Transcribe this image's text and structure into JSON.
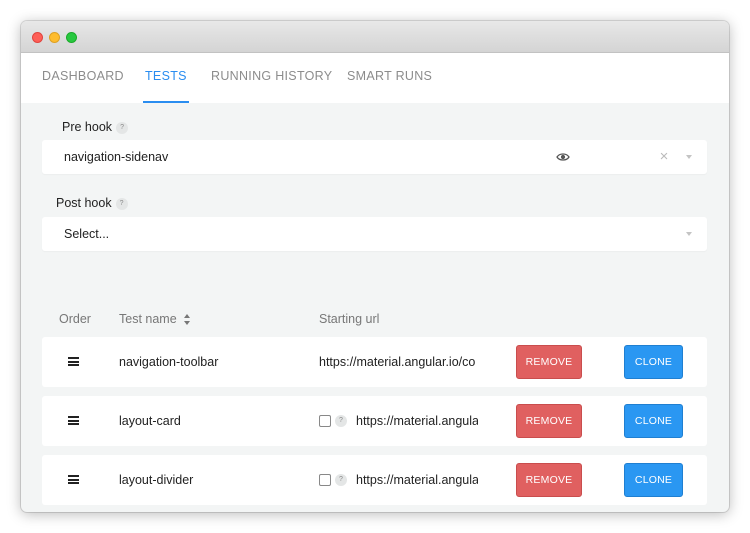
{
  "tabs": [
    {
      "label": "DASHBOARD",
      "active": false
    },
    {
      "label": "TESTS",
      "active": true
    },
    {
      "label": "RUNNING HISTORY",
      "active": false
    },
    {
      "label": "SMART RUNS",
      "active": false
    }
  ],
  "pre_hook": {
    "label": "Pre hook",
    "help": "?",
    "value": "navigation-sidenav",
    "clear": "×"
  },
  "post_hook": {
    "label": "Post hook",
    "help": "?",
    "placeholder": "Select..."
  },
  "table": {
    "columns": {
      "order": "Order",
      "test_name": "Test name",
      "starting_url": "Starting url"
    },
    "rows": [
      {
        "name": "navigation-toolbar",
        "url": "https://material.angular.io/co",
        "has_checkbox": false,
        "remove": "REMOVE",
        "clone": "CLONE"
      },
      {
        "name": "layout-card",
        "url": "https://material.angula",
        "has_checkbox": true,
        "help": "?",
        "remove": "REMOVE",
        "clone": "CLONE"
      },
      {
        "name": "layout-divider",
        "url": "https://material.angula",
        "has_checkbox": true,
        "help": "?",
        "remove": "REMOVE",
        "clone": "CLONE"
      }
    ]
  },
  "colors": {
    "accent": "#2a8df0",
    "remove": "#e06060",
    "clone": "#2a97f2"
  }
}
